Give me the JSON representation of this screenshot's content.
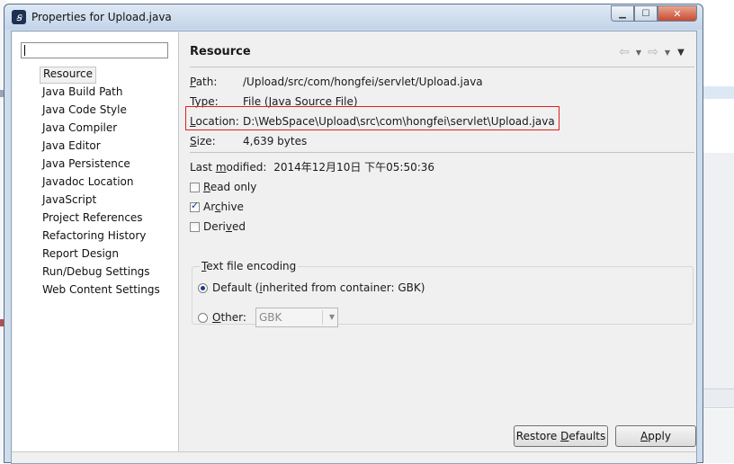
{
  "window": {
    "title": "Properties for Upload.java"
  },
  "filter": {
    "value": ""
  },
  "nav": {
    "items": [
      "Resource",
      "Java Build Path",
      "Java Code Style",
      "Java Compiler",
      "Java Editor",
      "Java Persistence",
      "Javadoc Location",
      "JavaScript",
      "Project References",
      "Refactoring History",
      "Report Design",
      "Run/Debug Settings",
      "Web Content Settings"
    ],
    "selected": "Resource"
  },
  "panel": {
    "title": "Resource",
    "path_label_u": "P",
    "path_label_rest": "ath:",
    "path_value": "/Upload/src/com/hongfei/servlet/Upload.java",
    "type_label_u": "T",
    "type_label_rest": "ype:",
    "type_value": "File  (Java Source File)",
    "location_label_u": "L",
    "location_label_rest": "ocation:",
    "location_value": "D:\\WebSpace\\Upload\\src\\com\\hongfei\\servlet\\Upload.java",
    "size_label_u": "S",
    "size_label_rest": "ize:",
    "size_value": "4,639  bytes",
    "modified_label_pre": "Last ",
    "modified_label_u": "m",
    "modified_label_rest": "odified:",
    "modified_value": "2014年12月10日 下午05:50:36",
    "read_only": {
      "u": "R",
      "rest": "ead only",
      "checked": false
    },
    "archive": {
      "pre": "Ar",
      "u": "c",
      "rest": "hive",
      "checked": true
    },
    "derived": {
      "pre": "Deri",
      "u": "v",
      "rest": "ed",
      "checked": false
    },
    "encoding": {
      "title_u": "T",
      "title_rest": "ext file encoding",
      "default_pre": "Default (",
      "default_u": "i",
      "default_rest": "nherited from container: GBK)",
      "other_u": "O",
      "other_rest": "ther:",
      "other_value": "GBK",
      "selected": "default"
    }
  },
  "buttons": {
    "restore_pre": "Restore ",
    "restore_u": "D",
    "restore_rest": "efaults",
    "apply_u": "A",
    "apply_rest": "pply"
  },
  "colors": {
    "highlight_box": "#e0201b",
    "window_frame": "#cfdcec"
  },
  "icons": {
    "app": "eclipse-app-icon",
    "back": "back-arrow-icon",
    "forward": "forward-arrow-icon",
    "menu": "view-menu-icon"
  }
}
